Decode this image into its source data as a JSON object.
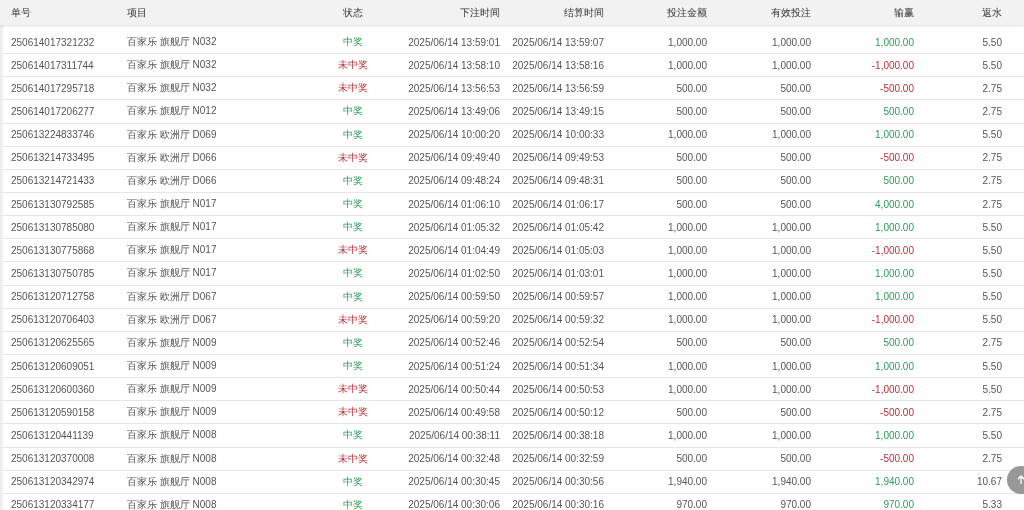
{
  "table": {
    "columns": [
      "单号",
      "项目",
      "状态",
      "下注时间",
      "结算时间",
      "投注金额",
      "有效投注",
      "输赢",
      "返水"
    ],
    "rows": [
      {
        "id": "250614017321232",
        "game": "百家乐 旗舰厅 N032",
        "status": "中奖",
        "won": true,
        "bet_time": "2025/06/14 13:59:01",
        "settle_time": "2025/06/14 13:59:07",
        "amount": "1,000.00",
        "valid": "1,000.00",
        "profit": "1,000.00",
        "rebate": "5.50"
      },
      {
        "id": "250614017311744",
        "game": "百家乐 旗舰厅 N032",
        "status": "未中奖",
        "won": false,
        "bet_time": "2025/06/14 13:58:10",
        "settle_time": "2025/06/14 13:58:16",
        "amount": "1,000.00",
        "valid": "1,000.00",
        "profit": "-1,000.00",
        "rebate": "5.50"
      },
      {
        "id": "250614017295718",
        "game": "百家乐 旗舰厅 N032",
        "status": "未中奖",
        "won": false,
        "bet_time": "2025/06/14 13:56:53",
        "settle_time": "2025/06/14 13:56:59",
        "amount": "500.00",
        "valid": "500.00",
        "profit": "-500.00",
        "rebate": "2.75"
      },
      {
        "id": "250614017206277",
        "game": "百家乐 旗舰厅 N012",
        "status": "中奖",
        "won": true,
        "bet_time": "2025/06/14 13:49:06",
        "settle_time": "2025/06/14 13:49:15",
        "amount": "500.00",
        "valid": "500.00",
        "profit": "500.00",
        "rebate": "2.75"
      },
      {
        "id": "250613224833746",
        "game": "百家乐 欧洲厅 D069",
        "status": "中奖",
        "won": true,
        "bet_time": "2025/06/14 10:00:20",
        "settle_time": "2025/06/14 10:00:33",
        "amount": "1,000.00",
        "valid": "1,000.00",
        "profit": "1,000.00",
        "rebate": "5.50"
      },
      {
        "id": "250613214733495",
        "game": "百家乐 欧洲厅 D066",
        "status": "未中奖",
        "won": false,
        "bet_time": "2025/06/14 09:49:40",
        "settle_time": "2025/06/14 09:49:53",
        "amount": "500.00",
        "valid": "500.00",
        "profit": "-500.00",
        "rebate": "2.75"
      },
      {
        "id": "250613214721433",
        "game": "百家乐 欧洲厅 D066",
        "status": "中奖",
        "won": true,
        "bet_time": "2025/06/14 09:48:24",
        "settle_time": "2025/06/14 09:48:31",
        "amount": "500.00",
        "valid": "500.00",
        "profit": "500.00",
        "rebate": "2.75"
      },
      {
        "id": "250613130792585",
        "game": "百家乐 旗舰厅 N017",
        "status": "中奖",
        "won": true,
        "bet_time": "2025/06/14 01:06:10",
        "settle_time": "2025/06/14 01:06:17",
        "amount": "500.00",
        "valid": "500.00",
        "profit": "4,000.00",
        "rebate": "2.75"
      },
      {
        "id": "250613130785080",
        "game": "百家乐 旗舰厅 N017",
        "status": "中奖",
        "won": true,
        "bet_time": "2025/06/14 01:05:32",
        "settle_time": "2025/06/14 01:05:42",
        "amount": "1,000.00",
        "valid": "1,000.00",
        "profit": "1,000.00",
        "rebate": "5.50"
      },
      {
        "id": "250613130775868",
        "game": "百家乐 旗舰厅 N017",
        "status": "未中奖",
        "won": false,
        "bet_time": "2025/06/14 01:04:49",
        "settle_time": "2025/06/14 01:05:03",
        "amount": "1,000.00",
        "valid": "1,000.00",
        "profit": "-1,000.00",
        "rebate": "5.50"
      },
      {
        "id": "250613130750785",
        "game": "百家乐 旗舰厅 N017",
        "status": "中奖",
        "won": true,
        "bet_time": "2025/06/14 01:02:50",
        "settle_time": "2025/06/14 01:03:01",
        "amount": "1,000.00",
        "valid": "1,000.00",
        "profit": "1,000.00",
        "rebate": "5.50"
      },
      {
        "id": "250613120712758",
        "game": "百家乐 欧洲厅 D067",
        "status": "中奖",
        "won": true,
        "bet_time": "2025/06/14 00:59:50",
        "settle_time": "2025/06/14 00:59:57",
        "amount": "1,000.00",
        "valid": "1,000.00",
        "profit": "1,000.00",
        "rebate": "5.50"
      },
      {
        "id": "250613120706403",
        "game": "百家乐 欧洲厅 D067",
        "status": "未中奖",
        "won": false,
        "bet_time": "2025/06/14 00:59:20",
        "settle_time": "2025/06/14 00:59:32",
        "amount": "1,000.00",
        "valid": "1,000.00",
        "profit": "-1,000.00",
        "rebate": "5.50"
      },
      {
        "id": "250613120625565",
        "game": "百家乐 旗舰厅 N009",
        "status": "中奖",
        "won": true,
        "bet_time": "2025/06/14 00:52:46",
        "settle_time": "2025/06/14 00:52:54",
        "amount": "500.00",
        "valid": "500.00",
        "profit": "500.00",
        "rebate": "2.75"
      },
      {
        "id": "250613120609051",
        "game": "百家乐 旗舰厅 N009",
        "status": "中奖",
        "won": true,
        "bet_time": "2025/06/14 00:51:24",
        "settle_time": "2025/06/14 00:51:34",
        "amount": "1,000.00",
        "valid": "1,000.00",
        "profit": "1,000.00",
        "rebate": "5.50"
      },
      {
        "id": "250613120600360",
        "game": "百家乐 旗舰厅 N009",
        "status": "未中奖",
        "won": false,
        "bet_time": "2025/06/14 00:50:44",
        "settle_time": "2025/06/14 00:50:53",
        "amount": "1,000.00",
        "valid": "1,000.00",
        "profit": "-1,000.00",
        "rebate": "5.50"
      },
      {
        "id": "250613120590158",
        "game": "百家乐 旗舰厅 N009",
        "status": "未中奖",
        "won": false,
        "bet_time": "2025/06/14 00:49:58",
        "settle_time": "2025/06/14 00:50:12",
        "amount": "500.00",
        "valid": "500.00",
        "profit": "-500.00",
        "rebate": "2.75"
      },
      {
        "id": "250613120441139",
        "game": "百家乐 旗舰厅 N008",
        "status": "中奖",
        "won": true,
        "bet_time": "2025/06/14 00:38:11",
        "settle_time": "2025/06/14 00:38:18",
        "amount": "1,000.00",
        "valid": "1,000.00",
        "profit": "1,000.00",
        "rebate": "5.50"
      },
      {
        "id": "250613120370008",
        "game": "百家乐 旗舰厅 N008",
        "status": "未中奖",
        "won": false,
        "bet_time": "2025/06/14 00:32:48",
        "settle_time": "2025/06/14 00:32:59",
        "amount": "500.00",
        "valid": "500.00",
        "profit": "-500.00",
        "rebate": "2.75"
      },
      {
        "id": "250613120342974",
        "game": "百家乐 旗舰厅 N008",
        "status": "中奖",
        "won": true,
        "bet_time": "2025/06/14 00:30:45",
        "settle_time": "2025/06/14 00:30:56",
        "amount": "1,940.00",
        "valid": "1,940.00",
        "profit": "1,940.00",
        "rebate": "10.67"
      },
      {
        "id": "250613120334177",
        "game": "百家乐 旗舰厅 N008",
        "status": "中奖",
        "won": true,
        "bet_time": "2025/06/14 00:30:06",
        "settle_time": "2025/06/14 00:30:16",
        "amount": "970.00",
        "valid": "970.00",
        "profit": "970.00",
        "rebate": "5.33"
      }
    ]
  }
}
